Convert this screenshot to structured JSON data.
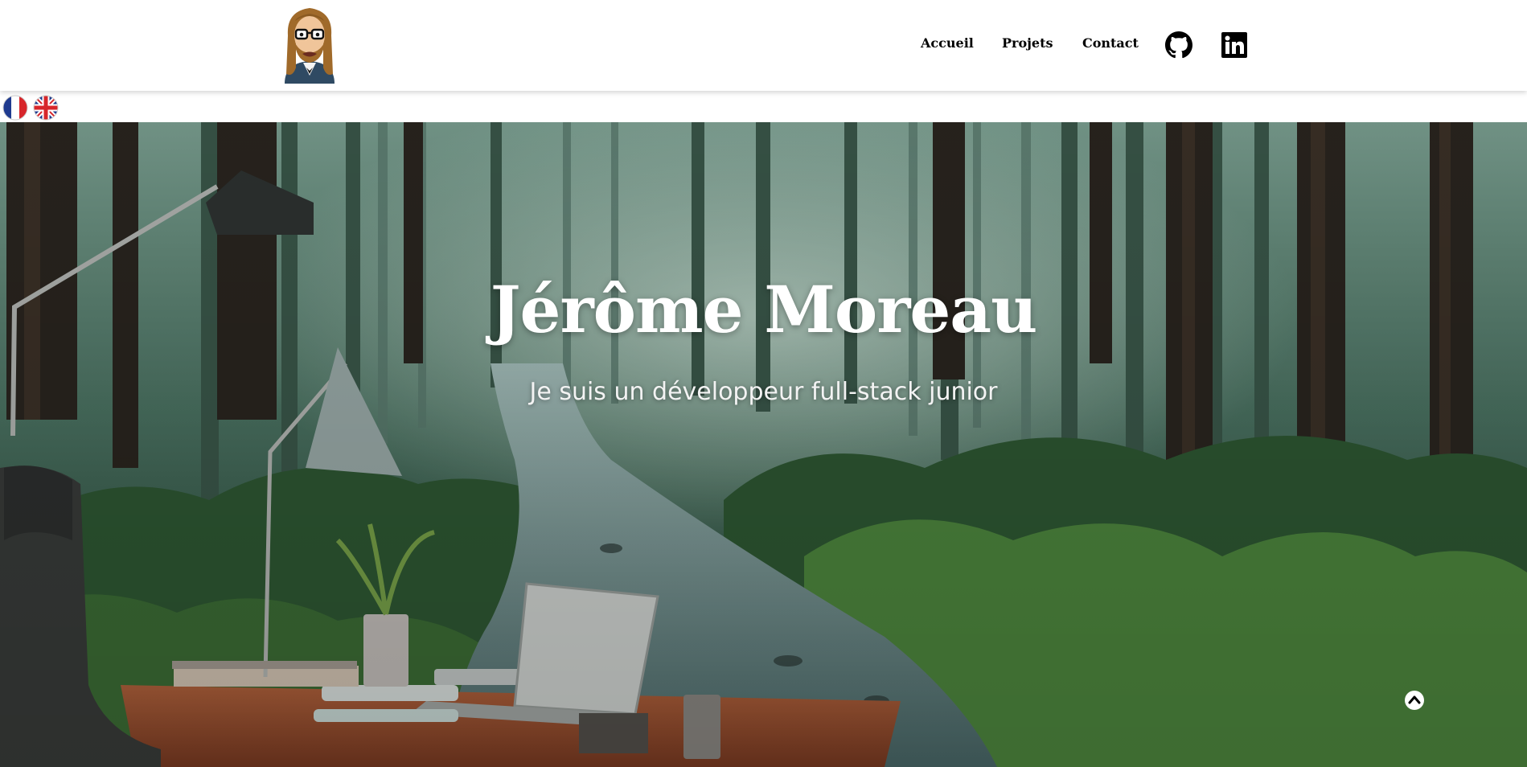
{
  "header": {
    "avatar_icon": "developer-avatar-icon",
    "nav": [
      {
        "label": "Accueil"
      },
      {
        "label": "Projets"
      },
      {
        "label": "Contact"
      }
    ],
    "social": [
      {
        "icon": "github-icon"
      },
      {
        "icon": "linkedin-icon"
      }
    ]
  },
  "languages": [
    {
      "icon": "french-flag-icon"
    },
    {
      "icon": "uk-flag-icon"
    }
  ],
  "hero": {
    "title": "Jérôme Moreau",
    "subtitle": "Je suis un développeur full-stack junior",
    "background": "forest-office-image"
  },
  "scroll_top_icon": "chevron-up-icon",
  "colors": {
    "header_bg": "#ffffff",
    "text_dark": "#000000",
    "hero_text": "#ffffff"
  }
}
